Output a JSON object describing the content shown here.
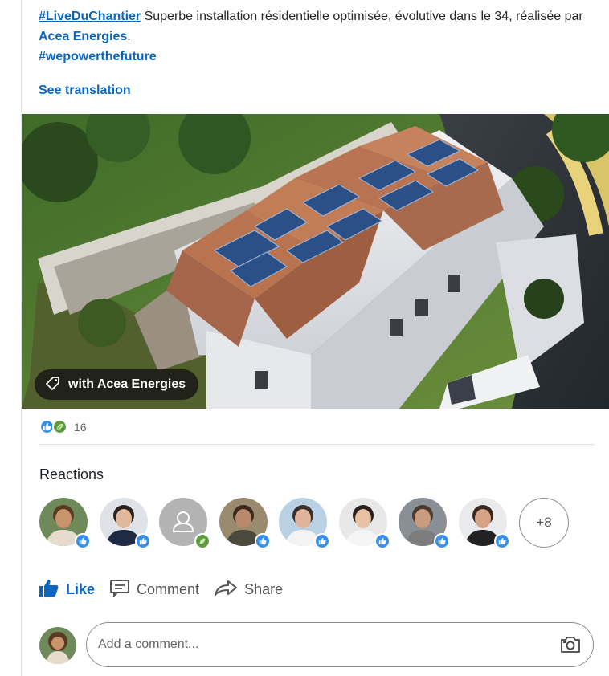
{
  "post": {
    "hashtag1": "#LiveDuChantier",
    "text_part1": " Superbe installation résidentielle optimisée, évolutive dans le 34, réalisée par ",
    "company_link": "Acea Energies",
    "text_part2": ".",
    "hashtag2": "#wepowerthefuture",
    "see_translation": "See translation"
  },
  "photo": {
    "tag_label": "with Acea Energies",
    "tag_icon": "tag-icon"
  },
  "social_counts": {
    "reaction_icons": [
      "like-reaction-icon",
      "support-reaction-icon"
    ],
    "count": "16"
  },
  "reactions": {
    "title": "Reactions",
    "more_label": "+8",
    "people": [
      {
        "badge": "like",
        "skin": "#c8946c",
        "hair": "#5a3a22",
        "shirt": "#e6dccd",
        "bg": "#6f8a5a"
      },
      {
        "badge": "like",
        "skin": "#e2b89c",
        "hair": "#2b2220",
        "shirt": "#1f2a44",
        "bg": "#dfe3e8"
      },
      {
        "badge": "support",
        "placeholder": true
      },
      {
        "badge": "like",
        "skin": "#b8896a",
        "hair": "#3b2a1e",
        "shirt": "#4a4a3c",
        "bg": "#9a8a6e"
      },
      {
        "badge": "like",
        "skin": "#e0b49a",
        "hair": "#3a2f2a",
        "shirt": "#f3f3f3",
        "bg": "#b9d1e3"
      },
      {
        "badge": "like",
        "skin": "#e7c1a4",
        "hair": "#2a1f1a",
        "shirt": "#f5f5f5",
        "bg": "#e8e8e8"
      },
      {
        "badge": "like",
        "skin": "#c99c7e",
        "hair": "#4a3a30",
        "shirt": "#7d7d7d",
        "bg": "#8a8f96"
      },
      {
        "badge": "like",
        "skin": "#d6a386",
        "hair": "#3a2a22",
        "shirt": "#222222",
        "bg": "#e9eaec"
      }
    ]
  },
  "actions": {
    "like": "Like",
    "comment": "Comment",
    "share": "Share"
  },
  "comment": {
    "placeholder": "Add a comment...",
    "camera_icon": "camera-icon"
  },
  "colors": {
    "link_blue": "#0a66c2",
    "like_blue": "#378fe9",
    "support_green": "#5f9b41"
  }
}
